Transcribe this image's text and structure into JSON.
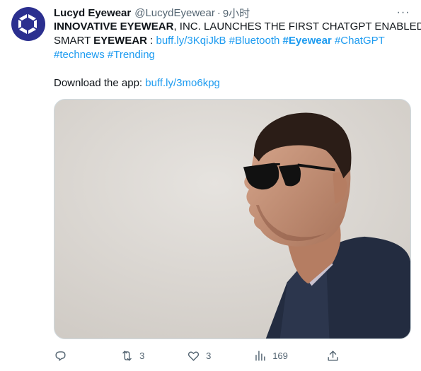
{
  "tweet": {
    "author_name": "Lucyd Eyewear",
    "handle": "@LucydEyewear",
    "separator": "·",
    "time": "9小时",
    "more_label": "···",
    "text": {
      "l1_bold1": "INNOVATIVE EYEWEAR",
      "l1_rest": ", INC. LAUNCHES THE FIRST CHATGPT ENABLED",
      "l2_pre": "SMART ",
      "l2_bold": "EYEWEAR",
      "l2_sep": " : ",
      "link1": "buff.ly/3KqiJkB",
      "tag_bluetooth": "#Bluetooth",
      "tag_eyewear": "#Eyewear",
      "tag_chatgpt": "#ChatGPT",
      "tag_technews": "#technews",
      "tag_trending": "#Trending",
      "download_label": "Download the app: ",
      "link2": "buff.ly/3mo6kpg"
    }
  },
  "actions": {
    "reply_count": "",
    "retweet_count": "3",
    "like_count": "3",
    "views_count": "169",
    "share_count": ""
  },
  "icons": {
    "avatar": "lucyd-logo-icon",
    "reply": "reply-icon",
    "retweet": "retweet-icon",
    "like": "heart-icon",
    "views": "views-icon",
    "share": "share-icon"
  },
  "colors": {
    "link": "#1d9bf0",
    "muted": "#536471",
    "text": "#0f1419",
    "avatar_bg": "#2b2f8f"
  }
}
